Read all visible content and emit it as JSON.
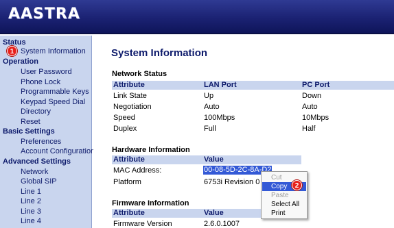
{
  "brand": {
    "logo_text": "AASTRA",
    "header_color": "#1b2273"
  },
  "sidebar": {
    "sections": [
      {
        "title": "Status",
        "items": [
          "System Information"
        ]
      },
      {
        "title": "Operation",
        "items": [
          "User Password",
          "Phone Lock",
          "Programmable Keys",
          "Keypad Speed Dial",
          "Directory",
          "Reset"
        ]
      },
      {
        "title": "Basic Settings",
        "items": [
          "Preferences",
          "Account Configuration"
        ]
      },
      {
        "title": "Advanced Settings",
        "items": [
          "Network",
          "Global SIP",
          "Line 1",
          "Line 2",
          "Line 3",
          "Line 4"
        ]
      }
    ]
  },
  "badges": {
    "step1": "1",
    "step2": "2"
  },
  "main": {
    "title": "System Information",
    "network_status": {
      "title": "Network Status",
      "headers": [
        "Attribute",
        "LAN Port",
        "PC Port"
      ],
      "rows": [
        [
          "Link State",
          "Up",
          "Down"
        ],
        [
          "Negotiation",
          "Auto",
          "Auto"
        ],
        [
          "Speed",
          "100Mbps",
          "10Mbps"
        ],
        [
          "Duplex",
          "Full",
          "Half"
        ]
      ]
    },
    "hardware_info": {
      "title": "Hardware Information",
      "headers": [
        "Attribute",
        "Value"
      ],
      "rows": [
        [
          "MAC Address:",
          "00-08-5D-2C-8A-D2"
        ],
        [
          "Platform",
          "6753i Revision 0"
        ]
      ]
    },
    "firmware_info": {
      "title": "Firmware Information",
      "headers": [
        "Attribute",
        "Value"
      ],
      "rows": [
        [
          "Firmware Version",
          "2.6.0.1007"
        ]
      ]
    }
  },
  "context_menu": {
    "items": [
      {
        "label": "Cut",
        "state": "disabled"
      },
      {
        "label": "Copy",
        "state": "active"
      },
      {
        "label": "Paste",
        "state": "disabled"
      },
      {
        "label": "Select All",
        "state": "enabled"
      },
      {
        "label": "Print",
        "state": "enabled"
      }
    ]
  }
}
